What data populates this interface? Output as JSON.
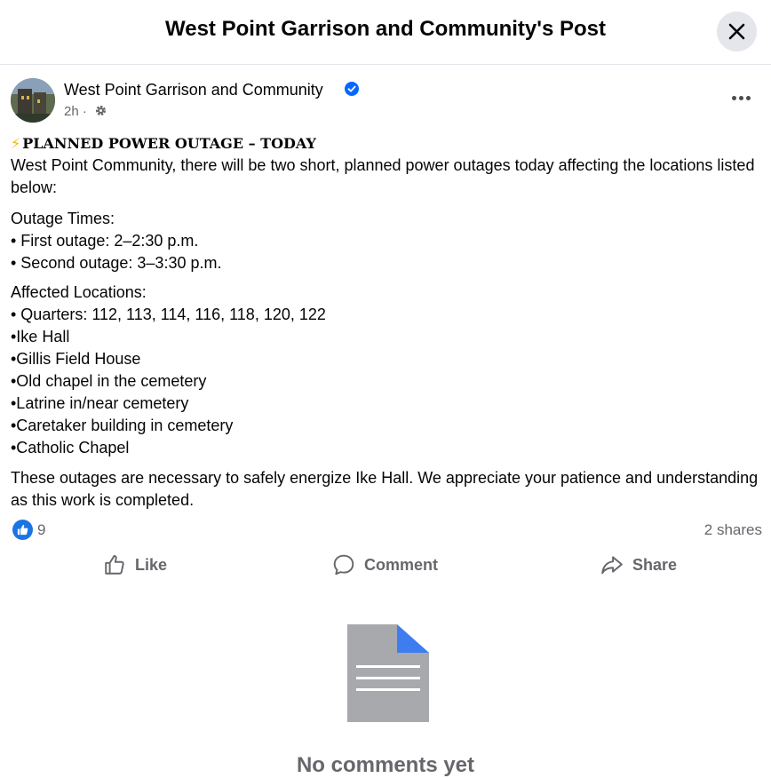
{
  "header": {
    "title": "West Point Garrison and Community's Post"
  },
  "post": {
    "author": "West Point Garrison and Community",
    "time": "2h",
    "separator": "·",
    "headline_icon": "⚡",
    "headline": "PLANNED POWER OUTAGE – TODAY",
    "intro": "West Point Community, there will be two short, planned power outages today affecting the locations listed below:",
    "times_heading": "Outage Times:",
    "times": [
      "• First outage: 2–2:30 p.m.",
      "• Second outage: 3–3:30 p.m."
    ],
    "locations_heading": "Affected Locations:",
    "locations": [
      "• Quarters: 112, 113, 114, 116, 118, 120, 122",
      "•Ike Hall",
      "•Gillis Field House",
      "•Old chapel in the cemetery",
      "•Latrine in/near cemetery",
      "•Caretaker building in cemetery",
      "•Catholic Chapel"
    ],
    "closing": "These outages are necessary to safely energize Ike Hall. We appreciate your patience and understanding as this work is completed."
  },
  "reactions": {
    "like_count": "9",
    "shares": "2 shares"
  },
  "actions": {
    "like": "Like",
    "comment": "Comment",
    "share": "Share"
  },
  "comments": {
    "empty_text": "No comments yet"
  },
  "colors": {
    "accent": "#1b74e4",
    "muted": "#65676b",
    "verified": "#0866ff"
  }
}
